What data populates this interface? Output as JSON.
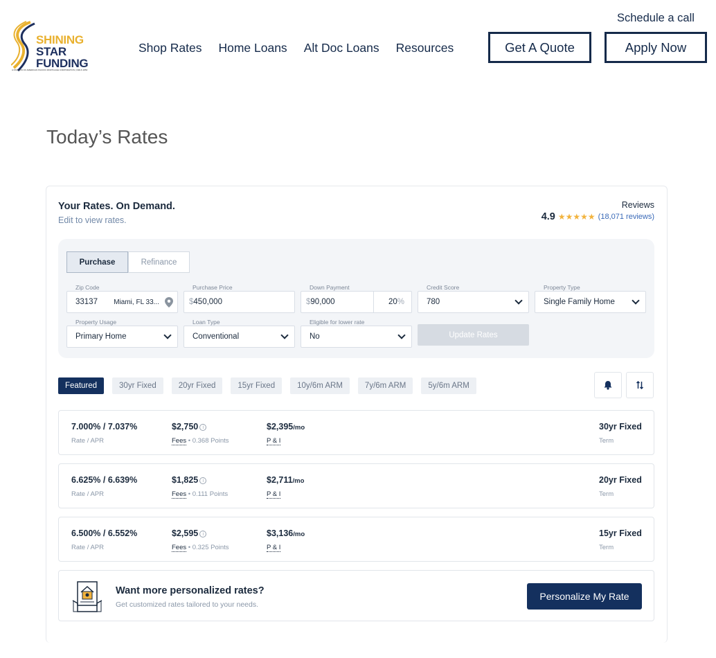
{
  "header": {
    "logo": {
      "line1": "SHINING",
      "line2": "STAR",
      "line3": "FUNDING",
      "tagline": "A DIVISION OF AMERICAN PACIFIC MORTGAGE CORPORATION | NMLS 1850"
    },
    "nav": [
      "Shop Rates",
      "Home Loans",
      "Alt Doc Loans",
      "Resources"
    ],
    "schedule_link": "Schedule a call",
    "quote_button": "Get A Quote",
    "apply_button": "Apply Now"
  },
  "page_title": "Today’s Rates",
  "card": {
    "title": "Your Rates. On Demand.",
    "subtitle": "Edit to view rates.",
    "reviews_label": "Reviews",
    "rating": "4.9",
    "stars": "★★★★★",
    "reviews_count": "(18,071 reviews)"
  },
  "form": {
    "tabs": [
      "Purchase",
      "Refinance"
    ],
    "zip": {
      "label": "Zip Code",
      "value": "33137",
      "location": "Miami, FL 33..."
    },
    "price": {
      "label": "Purchase Price",
      "symbol": "$",
      "value": "450,000"
    },
    "down": {
      "label": "Down Payment",
      "symbol": "$",
      "value": "90,000",
      "percent": "20",
      "percent_symbol": "%"
    },
    "credit": {
      "label": "Credit Score",
      "value": "780"
    },
    "property_type": {
      "label": "Property Type",
      "value": "Single Family Home"
    },
    "usage": {
      "label": "Property Usage",
      "value": "Primary Home"
    },
    "loan_type": {
      "label": "Loan Type",
      "value": "Conventional"
    },
    "eligible": {
      "label": "Eligible for lower rate",
      "value": "No"
    },
    "update_button": "Update Rates"
  },
  "filters": [
    "Featured",
    "30yr Fixed",
    "20yr Fixed",
    "15yr Fixed",
    "10y/6m ARM",
    "7y/6m ARM",
    "5y/6m ARM"
  ],
  "rates": [
    {
      "rate": "7.000% / 7.037%",
      "rate_label": "Rate / APR",
      "fees": "$2,750",
      "fees_label": "Fees",
      "points": "• 0.368 Points",
      "payment": "$2,395",
      "per": "/mo",
      "pi_label": "P & I",
      "term": "30yr Fixed",
      "term_label": "Term"
    },
    {
      "rate": "6.625% / 6.639%",
      "rate_label": "Rate / APR",
      "fees": "$1,825",
      "fees_label": "Fees",
      "points": "• 0.111 Points",
      "payment": "$2,711",
      "per": "/mo",
      "pi_label": "P & I",
      "term": "20yr Fixed",
      "term_label": "Term"
    },
    {
      "rate": "6.500% / 6.552%",
      "rate_label": "Rate / APR",
      "fees": "$2,595",
      "fees_label": "Fees",
      "points": "• 0.325 Points",
      "payment": "$3,136",
      "per": "/mo",
      "pi_label": "P & I",
      "term": "15yr Fixed",
      "term_label": "Term"
    }
  ],
  "personalize": {
    "title": "Want more personalized rates?",
    "subtitle": "Get customized rates tailored to your needs.",
    "button": "Personalize My Rate"
  },
  "colors": {
    "navy": "#14305e",
    "gold": "#e9b12f",
    "star": "#f2b33d"
  }
}
